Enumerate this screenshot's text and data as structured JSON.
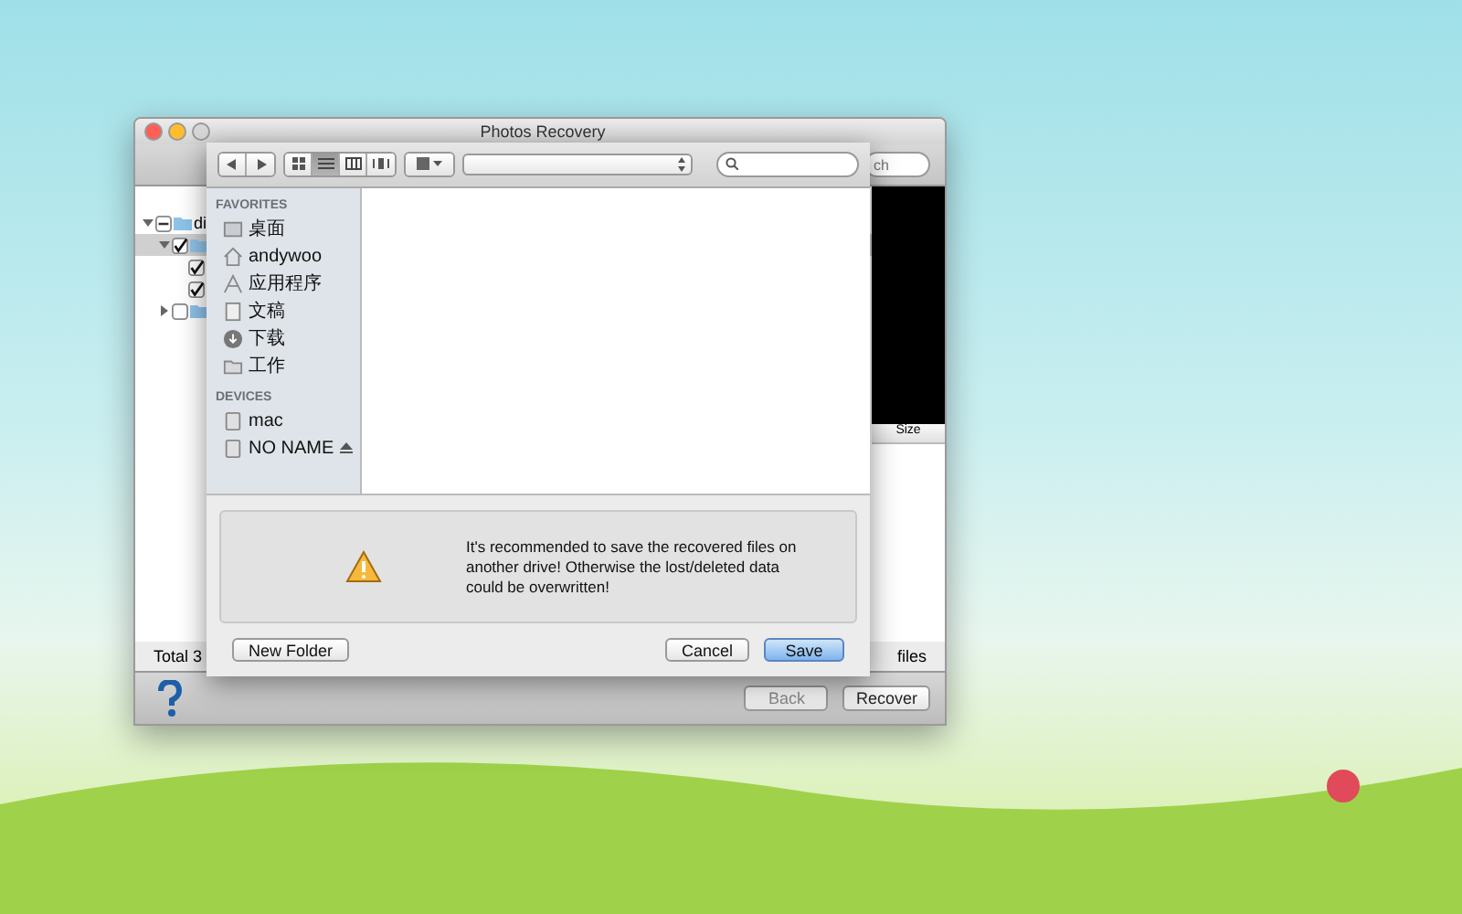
{
  "window": {
    "title": "Photos Recovery",
    "search_placeholder": "ch"
  },
  "tree": [
    {
      "label": "di",
      "expanded": true,
      "mixed": true,
      "selected": false,
      "children": [
        {
          "expanded": true,
          "checked": true,
          "selected": true,
          "children": [
            {
              "checked": true,
              "selected": false
            },
            {
              "checked": true,
              "selected": false
            }
          ]
        },
        {
          "expanded": false,
          "checked": false,
          "selected": false
        }
      ]
    }
  ],
  "preview": {
    "column": "Size"
  },
  "status": {
    "left": "Total 3",
    "right": "files"
  },
  "footer_buttons": [
    {
      "label": "Back",
      "disabled": true
    },
    {
      "label": "Recover",
      "disabled": false
    }
  ],
  "save_sheet": {
    "toolbar": {
      "views": [
        {
          "kind": "icons",
          "selected": false
        },
        {
          "kind": "list",
          "selected": true
        },
        {
          "kind": "columns",
          "selected": false
        },
        {
          "kind": "coverflow",
          "selected": false
        }
      ]
    },
    "sidebar": [
      {
        "heading": "FAVORITES",
        "items": [
          {
            "kind": "desktop",
            "label": "桌面"
          },
          {
            "kind": "home",
            "label": "andywoo"
          },
          {
            "kind": "apps",
            "label": "应用程序"
          },
          {
            "kind": "documents",
            "label": "文稿"
          },
          {
            "kind": "downloads",
            "label": "下载"
          },
          {
            "kind": "folder",
            "label": "工作"
          }
        ]
      },
      {
        "heading": "DEVICES",
        "items": [
          {
            "kind": "disk",
            "label": "mac",
            "eject": false
          },
          {
            "kind": "disk",
            "label": "NO NAME",
            "eject": true
          }
        ]
      }
    ],
    "message": "It's recommended to save the recovered files on another drive! Otherwise the lost/deleted data could be overwritten!",
    "buttons": [
      {
        "label": "New Folder",
        "kind": "secondary"
      },
      {
        "label": "Cancel",
        "kind": "secondary"
      },
      {
        "label": "Save",
        "kind": "default"
      }
    ]
  }
}
